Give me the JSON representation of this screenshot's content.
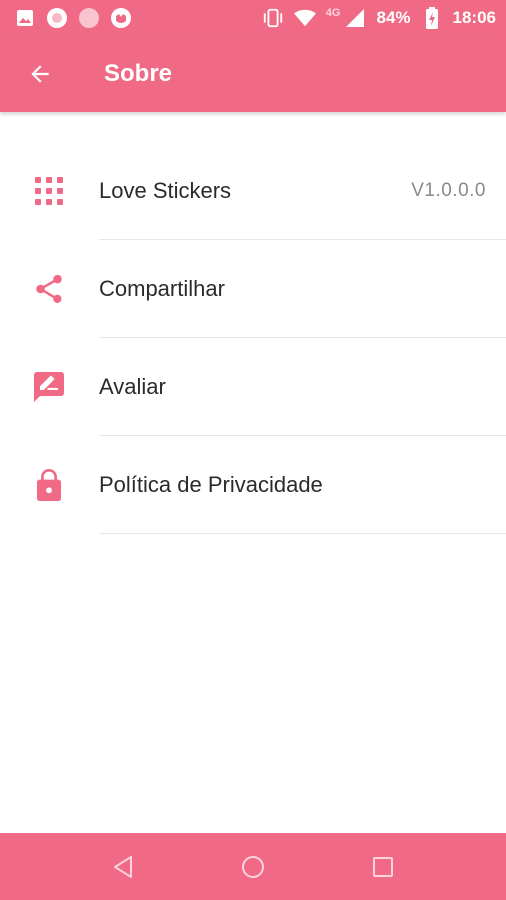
{
  "colors": {
    "accent": "#f06a85",
    "text": "#2b2b2b",
    "secondary": "#8a8a8a"
  },
  "status_bar": {
    "notification_icons": [
      "gallery-icon",
      "sticker-app-icon",
      "record-icon",
      "sticker-face-icon"
    ],
    "network_type": "4G",
    "battery": "84%",
    "time": "18:06"
  },
  "app_bar": {
    "title": "Sobre",
    "back_icon": "arrow-back-icon"
  },
  "menu": {
    "items": [
      {
        "label": "Love Stickers",
        "value": "V1.0.0.0",
        "icon": "grid-apps-icon"
      },
      {
        "label": "Compartilhar",
        "icon": "share-icon"
      },
      {
        "label": "Avaliar",
        "icon": "rate-review-icon"
      },
      {
        "label": "Política de Privacidade",
        "icon": "lock-icon"
      }
    ]
  },
  "nav_bar": {
    "buttons": [
      "back-triangle-icon",
      "home-circle-icon",
      "recents-square-icon"
    ]
  }
}
